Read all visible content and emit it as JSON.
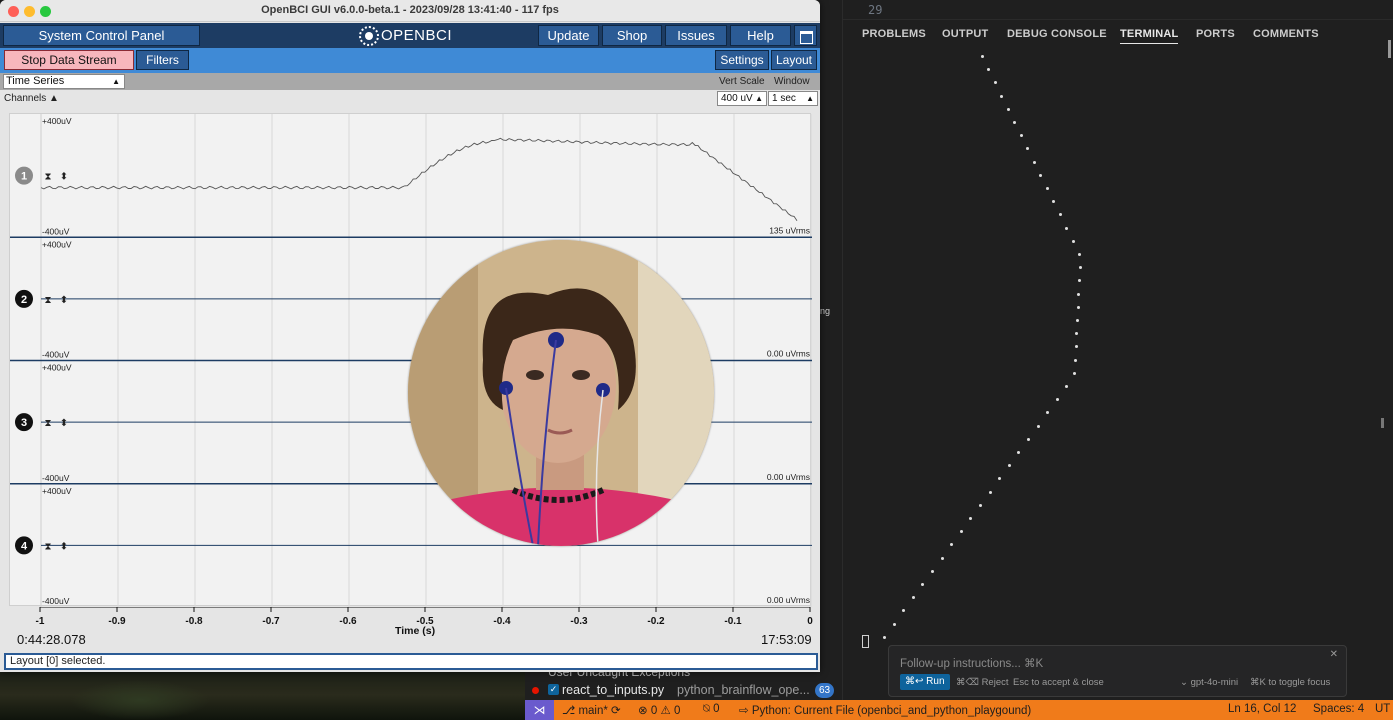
{
  "openbci": {
    "window_title": "OpenBCI GUI v6.0.0-beta.1 - 2023/09/28 13:41:40 - 117 fps",
    "topbar": {
      "system_control_panel": "System Control Panel",
      "logo_text": "OPENBCI",
      "update": "Update",
      "shop": "Shop",
      "issues": "Issues",
      "help": "Help"
    },
    "toolbar": {
      "stop_data_stream": "Stop Data Stream",
      "filters": "Filters",
      "settings": "Settings",
      "layout": "Layout"
    },
    "widget": {
      "selected": "Time Series",
      "vert_scale_label": "Vert Scale",
      "window_label": "Window",
      "channels_label": "Channels",
      "vert_scale_value": "400 uV",
      "window_value": "1 sec"
    },
    "channels": [
      {
        "number": "1",
        "top_label": "+400uV",
        "bottom_label": "-400uV",
        "rms": "135 uVrms"
      },
      {
        "number": "2",
        "top_label": "+400uV",
        "bottom_label": "-400uV",
        "rms": "0.00 uVrms"
      },
      {
        "number": "3",
        "top_label": "+400uV",
        "bottom_label": "-400uV",
        "rms": "0.00 uVrms"
      },
      {
        "number": "4",
        "top_label": "+400uV",
        "bottom_label": "-400uV",
        "rms": "0.00 uVrms"
      }
    ],
    "x_axis": {
      "label": "Time (s)",
      "ticks": [
        "-1",
        "-0.9",
        "-0.8",
        "-0.7",
        "-0.6",
        "-0.5",
        "-0.4",
        "-0.3",
        "-0.2",
        "-0.1",
        "0"
      ],
      "start_time": "0:44:28.078",
      "end_time": "17:53:09"
    },
    "status_message": "Layout [0] selected.",
    "colors": {
      "topbar_bg": "#1d3c63",
      "button_bg": "#2b5b95",
      "toolbar_bg": "#3f8ad6",
      "stop_button_bg": "#f7b6bd"
    }
  },
  "vscode": {
    "line_number": "29",
    "panel_tabs": [
      "PROBLEMS",
      "OUTPUT",
      "DEBUG CONSOLE",
      "TERMINAL",
      "PORTS",
      "COMMENTS"
    ],
    "active_tab": "TERMINAL",
    "side_fragment": "ing",
    "followup": {
      "placeholder": "Follow-up instructions... ⌘K",
      "run": "⌘↩ Run",
      "reject": "⌘⌫ Reject",
      "esc_hint": "Esc to accept & close",
      "model": "gpt-4o-mini",
      "toggle_focus": "⌘K to toggle focus",
      "close": "✕"
    },
    "debug": {
      "row1_text": "User Uncaught Exceptions",
      "file": "react_to_inputs.py",
      "path": "python_brainflow_ope...",
      "badge": "63"
    },
    "statusbar": {
      "branch": "main*",
      "errors": "0",
      "warnings": "0",
      "ports": "0",
      "interpreter": "Python: Current File (openbci_and_python_playgound)",
      "cursor": "Ln 16, Col 12",
      "spaces": "Spaces: 4",
      "encoding": "UT"
    },
    "colors": {
      "statusbar_bg": "#f07b1a",
      "remote_bg": "#6a5acd"
    }
  }
}
